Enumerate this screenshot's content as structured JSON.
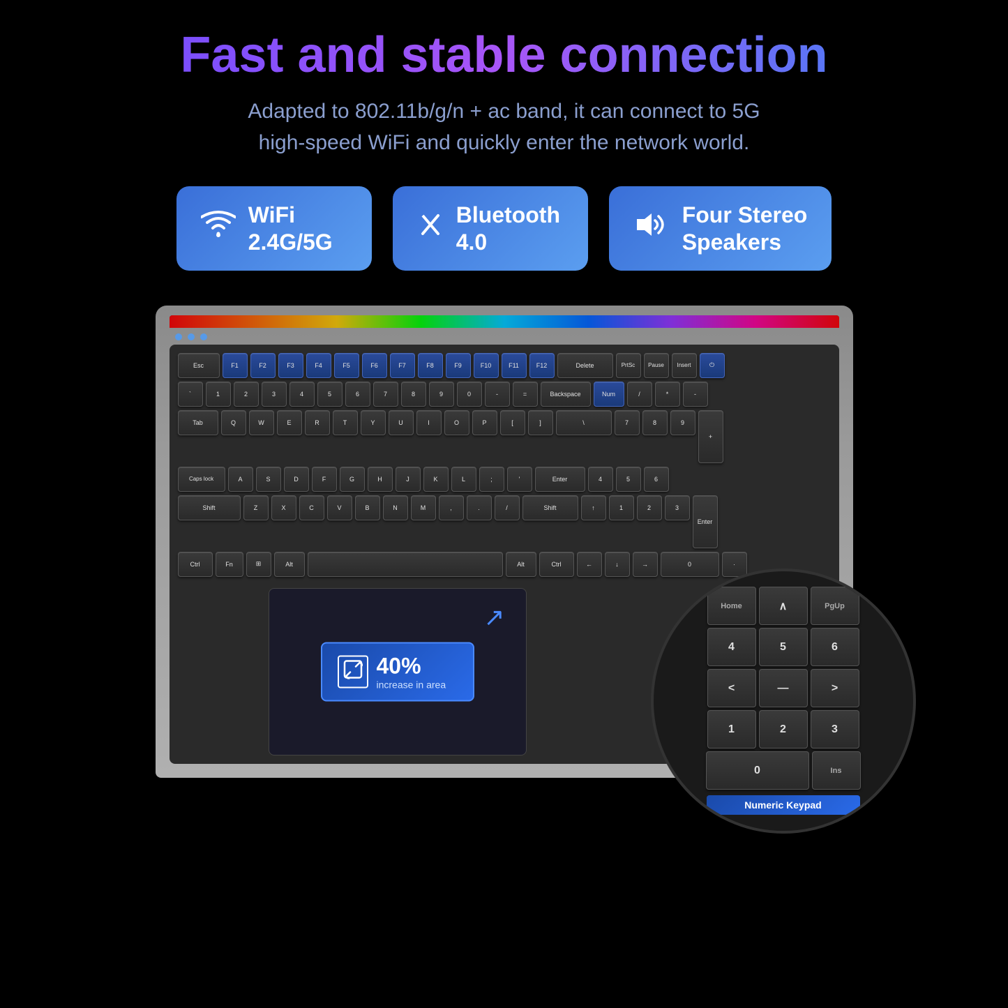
{
  "header": {
    "title": "Fast and stable connection",
    "subtitle_line1": "Adapted to 802.11b/g/n + ac band, it can connect to 5G",
    "subtitle_line2": "high-speed WiFi and quickly enter the network world."
  },
  "badges": [
    {
      "id": "wifi",
      "icon": "wifi",
      "label_line1": "WiFi",
      "label_line2": "2.4G/5G"
    },
    {
      "id": "bluetooth",
      "icon": "bluetooth",
      "label_line1": "Bluetooth",
      "label_line2": "4.0"
    },
    {
      "id": "speakers",
      "icon": "speaker",
      "label_line1": "Four Stereo",
      "label_line2": "Speakers"
    }
  ],
  "trackpad": {
    "percent": "40%",
    "label": "increase in area"
  },
  "numpad_circle": {
    "badge_label": "Numeric Keypad",
    "rows": [
      [
        "Home",
        "∧",
        "PgUp"
      ],
      [
        "4",
        "5",
        "6"
      ],
      [
        "<",
        "—",
        ">"
      ],
      [
        "1",
        "2",
        "3"
      ],
      [
        "0",
        "Ins"
      ]
    ]
  },
  "keyboard": {
    "fn_row": [
      "Esc",
      "F1",
      "F2",
      "F3",
      "F4",
      "F5",
      "F6",
      "F7",
      "F8",
      "F9",
      "F10",
      "F11",
      "F12",
      "Delete",
      "PrtSc",
      "Pause",
      "Insert",
      "⏻"
    ],
    "row1": [
      "`",
      "1",
      "2",
      "3",
      "4",
      "5",
      "6",
      "7",
      "8",
      "9",
      "0",
      "-",
      "=",
      "Backspace",
      "Num",
      "/",
      "*",
      "-"
    ],
    "row2": [
      "Tab",
      "Q",
      "W",
      "E",
      "R",
      "T",
      "Y",
      "U",
      "I",
      "O",
      "P",
      "[",
      "]",
      "\\",
      "7",
      "8",
      "9"
    ],
    "row3": [
      "Caps",
      "A",
      "S",
      "D",
      "F",
      "G",
      "H",
      "J",
      "K",
      "L",
      ";",
      "'",
      "Enter",
      "4",
      "5",
      "6",
      "+"
    ],
    "row4": [
      "Shift",
      "Z",
      "X",
      "C",
      "V",
      "B",
      "N",
      "M",
      ",",
      ".",
      "/",
      "Shift",
      "↑",
      "1",
      "2",
      "3"
    ],
    "row5": [
      "Ctrl",
      "Fn",
      "⊞",
      "Alt",
      "Space",
      "Alt",
      "Ctrl",
      "←",
      "↓",
      "→",
      "0",
      "·",
      "Enter"
    ]
  }
}
